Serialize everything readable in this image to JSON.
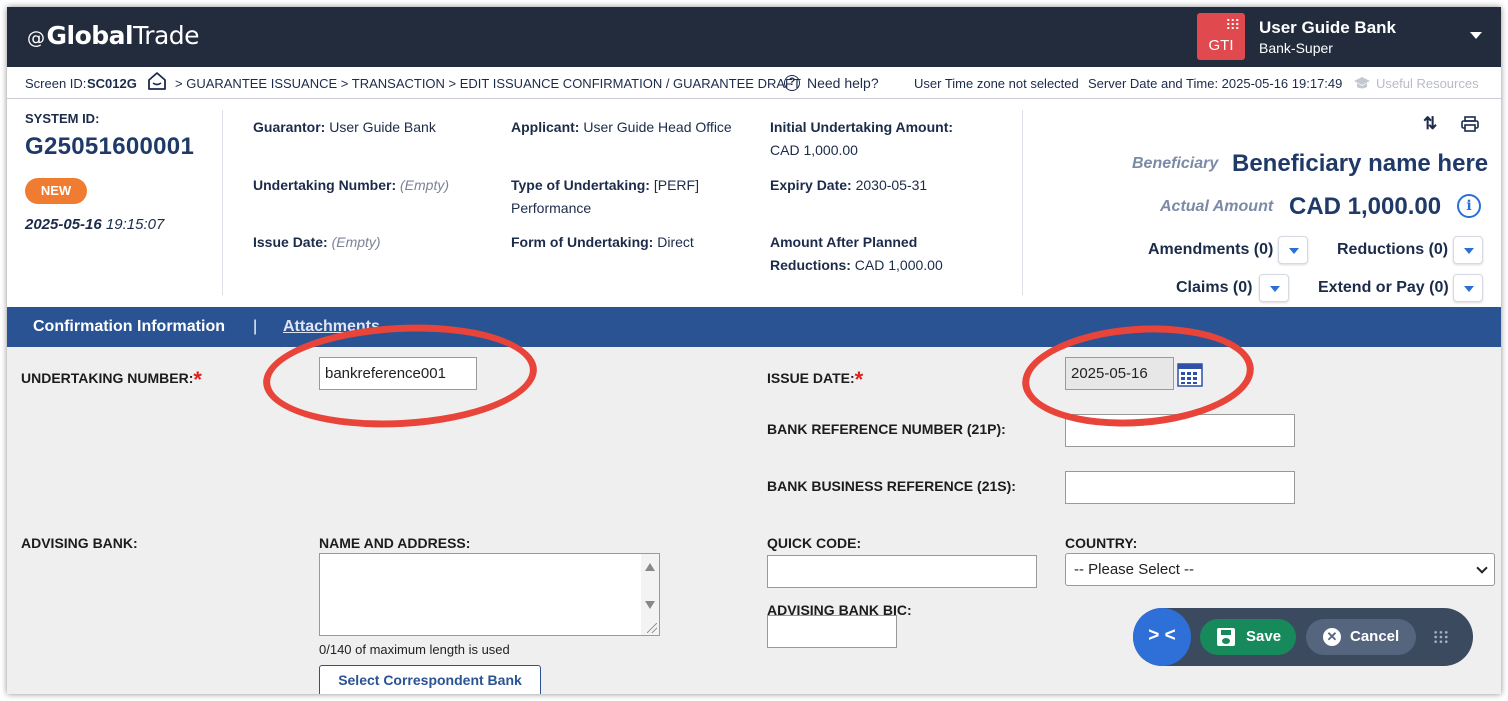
{
  "header": {
    "logo_prefix": "@",
    "logo_bold": "Global",
    "logo_rest": "Trade",
    "bank_badge": "GTI",
    "bank_name": "User Guide Bank",
    "bank_role": "Bank-Super"
  },
  "crumbs": {
    "screen_id_label": "Screen ID:",
    "screen_id": "SC012G",
    "path": "> GUARANTEE ISSUANCE > TRANSACTION > EDIT ISSUANCE CONFIRMATION / GUARANTEE DRAFT",
    "help": "Need help?",
    "timezone": "User Time zone not selected",
    "server_time": "Server Date and Time: 2025-05-16 19:17:49",
    "resources": "Useful Resources"
  },
  "summary": {
    "system_id_label": "SYSTEM ID:",
    "system_id": "G25051600001",
    "status_badge": "NEW",
    "created_date": "2025-05-16",
    "created_time": "19:15:07",
    "guarantor_label": "Guarantor:",
    "guarantor": "User Guide Bank",
    "applicant_label": "Applicant:",
    "applicant": "User Guide Head Office",
    "initial_amount_label": "Initial Undertaking Amount:",
    "initial_amount": "CAD 1,000.00",
    "undertaking_number_label": "Undertaking Number:",
    "undertaking_number": "(Empty)",
    "type_label": "Type of Undertaking:",
    "type": "[PERF] Performance",
    "expiry_label": "Expiry Date:",
    "expiry": "2030-05-31",
    "issue_date_label": "Issue Date:",
    "issue_date": "(Empty)",
    "form_label": "Form of Undertaking:",
    "form": "Direct",
    "after_reductions_label_1": "Amount After Planned",
    "after_reductions_label_2": "Reductions:",
    "after_reductions": "CAD 1,000.00",
    "beneficiary_label": "Beneficiary",
    "beneficiary": "Beneficiary name here",
    "actual_amount_label": "Actual Amount",
    "actual_amount": "CAD 1,000.00",
    "amendments": "Amendments (0)",
    "reductions": "Reductions (0)",
    "claims": "Claims (0)",
    "extend_or_pay": "Extend or Pay (0)"
  },
  "tabs": {
    "confirmation": "Confirmation Information",
    "separator": "|",
    "attachments": "Attachments"
  },
  "form": {
    "undertaking_number_label": "UNDERTAKING NUMBER:",
    "undertaking_number_value": "bankreference001",
    "issue_date_label": "ISSUE DATE:",
    "issue_date_value": "2025-05-16",
    "bank_ref_label": "BANK REFERENCE NUMBER (21P):",
    "bank_ref_value": "",
    "bank_business_ref_label": "BANK BUSINESS REFERENCE (21S):",
    "bank_business_ref_value": "",
    "advising_bank_label": "ADVISING BANK:",
    "name_address_label": "NAME AND ADDRESS:",
    "char_count": "0/140 of maximum length is used",
    "select_correspondent": "Select Correspondent Bank",
    "quick_code_label": "QUICK CODE:",
    "quick_code_value": "",
    "advising_bic_label": "ADVISING BANK BIC:",
    "advising_bic_value": "",
    "country_label": "COUNTRY:",
    "country_value": "-- Please Select --",
    "required_mark": "*"
  },
  "toolbar": {
    "toggle": "> <",
    "save": "Save",
    "cancel": "Cancel"
  },
  "colors": {
    "header_bg": "#232c3d",
    "tab_bar": "#2a5394",
    "badge_new": "#f07c31",
    "save": "#178a5c",
    "annotation": "#e8443a"
  }
}
